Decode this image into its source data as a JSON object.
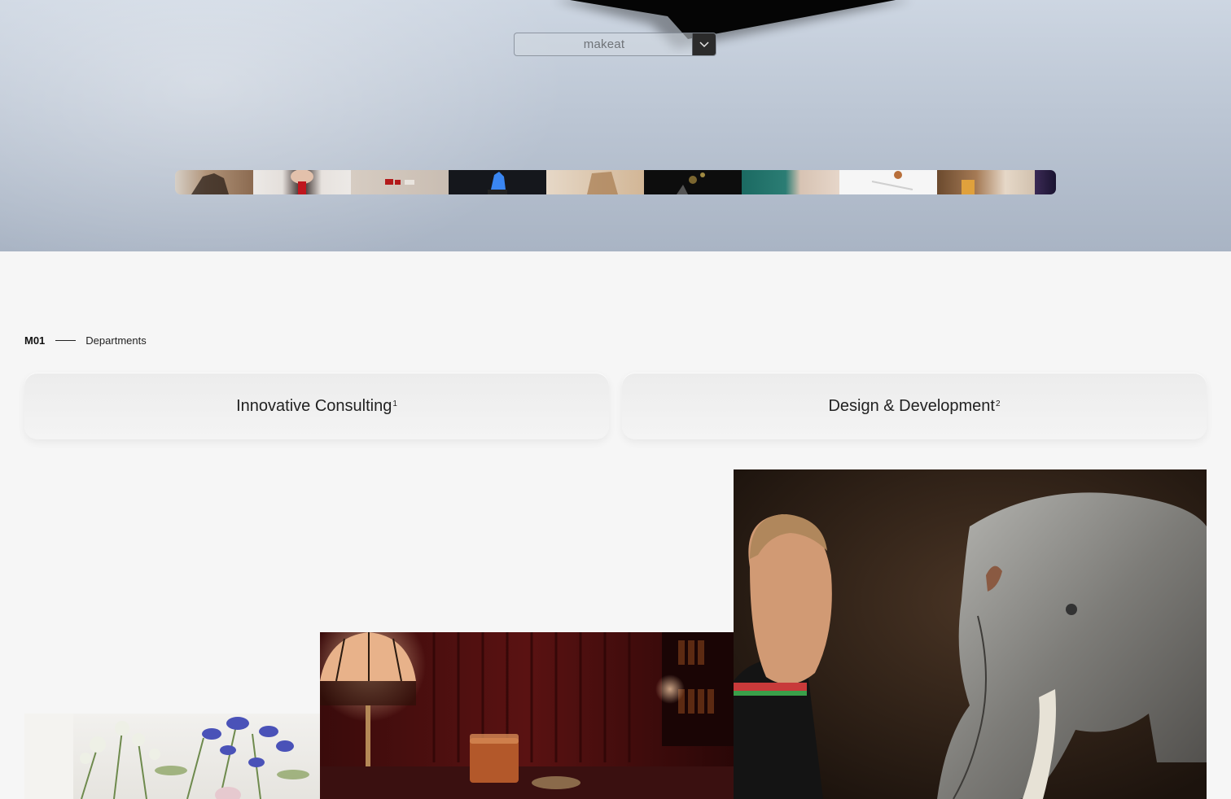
{
  "hero": {
    "brand": "makeat",
    "thumbnails": [
      {
        "name": "hand-fan",
        "colors": [
          "#a78a6e",
          "#8d6b52"
        ]
      },
      {
        "name": "woman-red-lips",
        "colors": [
          "#e8e4e0",
          "#2a1d1a"
        ]
      },
      {
        "name": "red-objects",
        "colors": [
          "#cfc4b9",
          "#b12020"
        ]
      },
      {
        "name": "blue-glow",
        "colors": [
          "#111318",
          "#2d6fe0"
        ]
      },
      {
        "name": "wooden-structure",
        "colors": [
          "#d8c2a6",
          "#a57a4f"
        ]
      },
      {
        "name": "gold-dark",
        "colors": [
          "#0e0e0e",
          "#6b5a2a"
        ]
      },
      {
        "name": "teal-fabric",
        "colors": [
          "#1d6e66",
          "#d9c6b6"
        ]
      },
      {
        "name": "white-plate",
        "colors": [
          "#f4f4f4",
          "#cfcfcf"
        ]
      },
      {
        "name": "honey-drink",
        "colors": [
          "#6b4a2e",
          "#e5d8c8"
        ]
      },
      {
        "name": "purple-end",
        "colors": [
          "#3b2a55",
          "#1a1330"
        ]
      }
    ]
  },
  "departments": {
    "number": "M01",
    "label": "Departments",
    "cards": [
      {
        "title": "Innovative Consulting",
        "sup": "1"
      },
      {
        "title": "Design & Development",
        "sup": "2"
      }
    ]
  },
  "gallery": {
    "items": [
      {
        "name": "flowers-photo"
      },
      {
        "name": "cocktail-bar-photo"
      },
      {
        "name": "chef-elephant-photo"
      }
    ]
  }
}
